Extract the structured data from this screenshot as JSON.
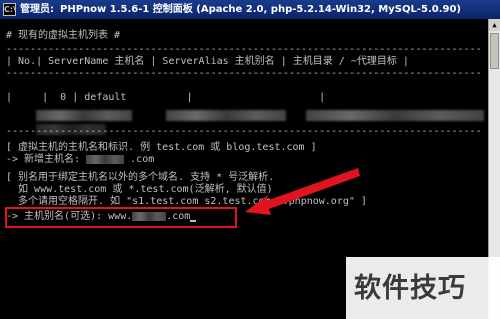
{
  "window": {
    "label": "管理员:",
    "title": "PHPnow 1.5.6-1 控制面板 (Apache 2.0, php-5.2.14-Win32, MySQL-5.0.90)"
  },
  "console": {
    "section_header": "# 现有的虚拟主机列表 #",
    "separator": "-------------------------------------------------------------------------------",
    "table_header": "| No.| ServerName 主机名 | ServerAlias 主机别名 | 主机目录 / ~代理目标 |",
    "row1_no": "|  0 |",
    "row1_name": "default",
    "row1_alias_sep": "|",
    "row1_dir_sep": "|",
    "row2_left": "|",
    "host_hint": "[ 虚拟主机的主机名和标识. 例 test.com 或 blog.test.com ]",
    "new_host_prompt": "-> 新增主机名:",
    "new_host_suffix": ".com",
    "alias_hint_1": "[ 别名用于绑定主机名以外的多个域名. 支持 * 号泛解析.",
    "alias_hint_2": "  如 www.test.com 或 *.test.com(泛解析, 默认值)",
    "alias_hint_3": "  多个请用空格隔开. 如 \"s1.test.com s2.test.com *.phpnow.org\" ]",
    "alias_prompt": "-> 主机别名(可选):",
    "alias_prefix": "www.",
    "alias_suffix": ".com"
  },
  "watermark": {
    "text": "软件技巧"
  },
  "colors": {
    "console_bg": "#000000",
    "console_text": "#c0c0c0",
    "annotation_red": "#e0141e",
    "titlebar": "#0a246a"
  },
  "icons": {
    "app": "console-icon",
    "annotation": "red-arrow"
  }
}
